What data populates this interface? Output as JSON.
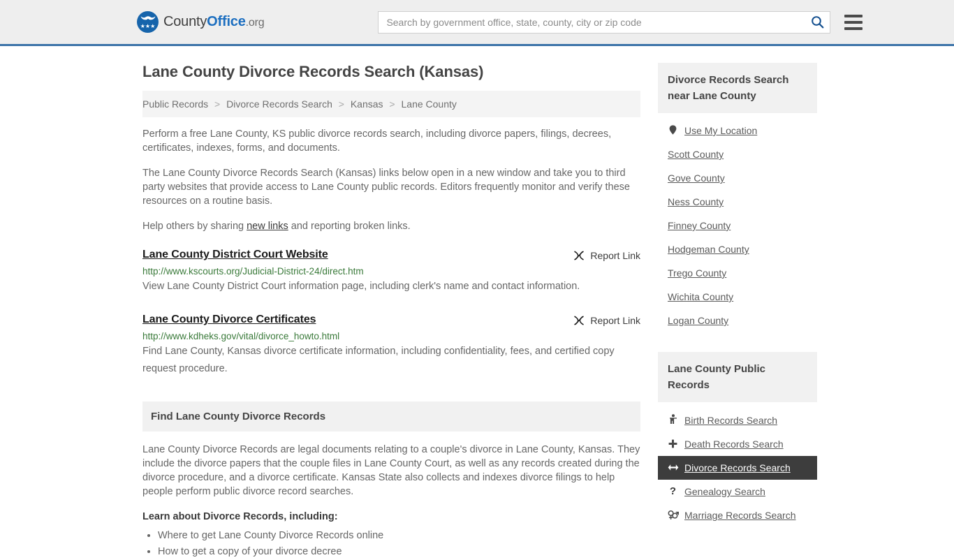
{
  "header": {
    "brand": {
      "part1": "County",
      "part2": "Office",
      "part3": ".org",
      "logo_icon": "eagle-stars-emblem",
      "stars": "★★★"
    },
    "search": {
      "placeholder": "Search by government office, state, county, city or zip code",
      "value": "",
      "search_icon": "magnifier-icon"
    },
    "menu_icon": "hamburger-menu-icon"
  },
  "main": {
    "title": "Lane County Divorce Records Search (Kansas)",
    "breadcrumb": [
      {
        "label": "Public Records",
        "current": false
      },
      {
        "label": "Divorce Records Search",
        "current": false
      },
      {
        "label": "Kansas",
        "current": false
      },
      {
        "label": "Lane County",
        "current": true
      }
    ],
    "breadcrumb_separator": ">",
    "intro_1": "Perform a free Lane County, KS public divorce records search, including divorce papers, filings, decrees, certificates, indexes, forms, and documents.",
    "intro_2": "The Lane County Divorce Records Search (Kansas) links below open in a new window and take you to third party websites that provide access to Lane County public records. Editors frequently monitor and verify these resources on a routine basis.",
    "help_prefix": "Help others by sharing ",
    "help_link": "new links",
    "help_suffix": " and reporting broken links.",
    "report_label": "Report Link",
    "report_icon": "broken-link-icon",
    "results": [
      {
        "title": "Lane County District Court Website",
        "url": "http://www.kscourts.org/Judicial-District-24/direct.htm",
        "description": "View Lane County District Court information page, including clerk's name and contact information."
      },
      {
        "title": "Lane County Divorce Certificates",
        "url": "http://www.kdheks.gov/vital/divorce_howto.html",
        "description": "Find Lane County, Kansas divorce certificate information, including confidentiality, fees, and certified copy request procedure."
      }
    ],
    "section_title": "Find Lane County Divorce Records",
    "section_body": "Lane County Divorce Records are legal documents relating to a couple's divorce in Lane County, Kansas. They include the divorce papers that the couple files in Lane County Court, as well as any records created during the divorce procedure, and a divorce certificate. Kansas State also collects and indexes divorce filings to help people perform public divorce record searches.",
    "learn_heading": "Learn about Divorce Records, including:",
    "learn_items": [
      "Where to get Lane County Divorce Records online",
      "How to get a copy of your divorce decree"
    ]
  },
  "sidebar": {
    "nearby": {
      "title": "Divorce Records Search near Lane County",
      "items": [
        {
          "label": "Use My Location",
          "icon": "map-pin-icon",
          "glyph": "⮟",
          "has_icon": true
        },
        {
          "label": "Scott County",
          "icon": "",
          "glyph": "",
          "has_icon": false
        },
        {
          "label": "Gove County",
          "icon": "",
          "glyph": "",
          "has_icon": false
        },
        {
          "label": "Ness County",
          "icon": "",
          "glyph": "",
          "has_icon": false
        },
        {
          "label": "Finney County",
          "icon": "",
          "glyph": "",
          "has_icon": false
        },
        {
          "label": "Hodgeman County",
          "icon": "",
          "glyph": "",
          "has_icon": false
        },
        {
          "label": "Trego County",
          "icon": "",
          "glyph": "",
          "has_icon": false
        },
        {
          "label": "Wichita County",
          "icon": "",
          "glyph": "",
          "has_icon": false
        },
        {
          "label": "Logan County",
          "icon": "",
          "glyph": "",
          "has_icon": false
        }
      ]
    },
    "public_records": {
      "title": "Lane County Public Records",
      "items": [
        {
          "label": "Birth Records Search",
          "icon": "baby-icon",
          "glyph": "\u0001",
          "active": false
        },
        {
          "label": "Death Records Search",
          "icon": "cross-icon",
          "glyph": "✚",
          "active": false
        },
        {
          "label": "Divorce Records Search",
          "icon": "arrows-left-right-icon",
          "glyph": "↔",
          "active": true
        },
        {
          "label": "Genealogy Search",
          "icon": "question-mark-icon",
          "glyph": "?",
          "active": false
        },
        {
          "label": "Marriage Records Search",
          "icon": "male-female-icon",
          "glyph": "⚥",
          "active": false
        }
      ]
    }
  },
  "colors": {
    "header_bg": "#eeeeee",
    "header_border": "#3a72a8",
    "brand_blue": "#1d6fc0",
    "url_green": "#3a7a3a",
    "active_bg": "#3d3d3d",
    "panel_bg": "#f1f1f1"
  }
}
